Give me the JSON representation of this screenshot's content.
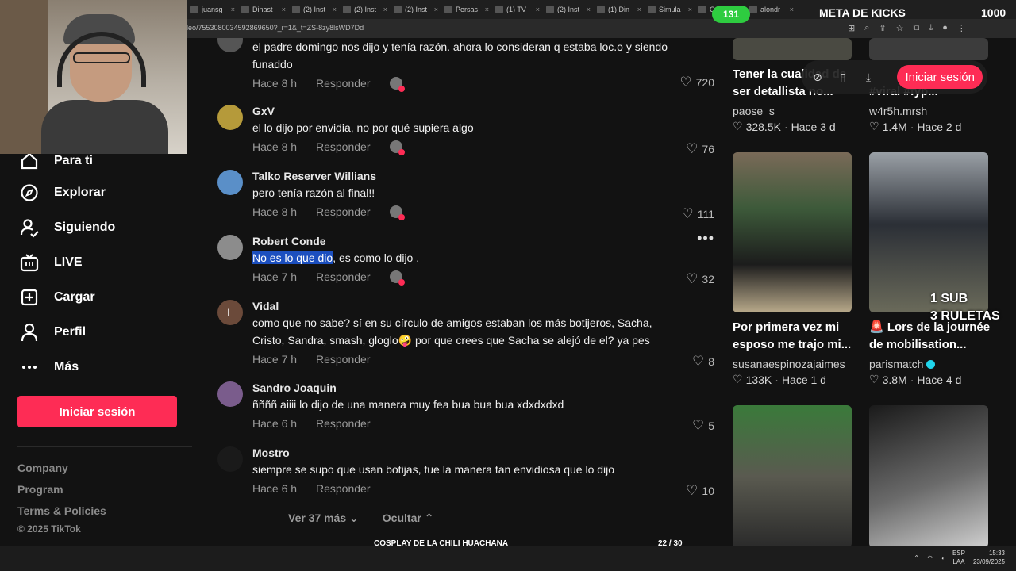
{
  "browser": {
    "tabs": [
      "juansg",
      "Dinast",
      "(2) Inst",
      "(2) Inst",
      "(2) Inst",
      "Persas",
      "(1) TV",
      "(2) Inst",
      "(1) Din",
      "Simula",
      "Quién",
      "alondr"
    ],
    "url": "deo/7553080034592869650?_r=1&_t=ZS-8zy8lsWD7Dd"
  },
  "sidebar": {
    "items": [
      {
        "label": "Para ti",
        "icon": "home-icon"
      },
      {
        "label": "Explorar",
        "icon": "compass-icon"
      },
      {
        "label": "Siguiendo",
        "icon": "following-icon"
      },
      {
        "label": "LIVE",
        "icon": "live-icon"
      },
      {
        "label": "Cargar",
        "icon": "upload-icon"
      },
      {
        "label": "Perfil",
        "icon": "profile-icon"
      },
      {
        "label": "Más",
        "icon": "more-icon"
      }
    ],
    "login_button": "Iniciar sesión",
    "footer": [
      "Company",
      "Program",
      "Terms & Policies"
    ],
    "copyright": "© 2025 TikTok"
  },
  "comments": [
    {
      "user": "",
      "text": "el padre domingo nos dijo y tenía razón. ahora lo consideran q estaba loc.o y siendo funaddo",
      "time": "Hace 8 h",
      "reply": "Responder",
      "likes": "720"
    },
    {
      "user": "GxV",
      "text": "el lo dijo por envidia, no por qué supiera algo",
      "time": "Hace 8 h",
      "reply": "Responder",
      "likes": "76"
    },
    {
      "user": "Talko Reserver Willians",
      "text": "pero tenía razón al final!!",
      "time": "Hace 8 h",
      "reply": "Responder",
      "likes": "111"
    },
    {
      "user": "Robert Conde",
      "text_selected": "No es lo que dio",
      "text_rest": ", es como lo dijo .",
      "time": "Hace 7 h",
      "reply": "Responder",
      "likes": "32"
    },
    {
      "user": "Vidal",
      "avatar_letter": "L",
      "text": "como que no sabe? sí en su círculo de amigos estaban los más botijeros, Sacha, Cristo, Sandra, smash, gloglo🤪 por que crees que Sacha se alejó de el? ya pes",
      "time": "Hace 7 h",
      "reply": "Responder",
      "likes": "8"
    },
    {
      "user": "Sandro Joaquin",
      "text": "ññññ aiiii lo dijo de una manera muy fea bua bua bua xdxdxdxd",
      "time": "Hace 6 h",
      "reply": "Responder",
      "likes": "5"
    },
    {
      "user": "Mostro",
      "text": "siempre se supo que usan botijas, fue la manera tan envidiosa que lo dijo",
      "time": "Hace 6 h",
      "reply": "Responder",
      "likes": "10"
    }
  ],
  "comment_controls": {
    "more": "Ver 37 más",
    "hide": "Ocultar"
  },
  "float_bar": {
    "login": "Iniciar sesión"
  },
  "videos": [
    {
      "title": "Tener la cualidad de ser detallista no...",
      "user": "paose_s",
      "likes": "328.5K",
      "time": "Hace 3 d",
      "verified": false
    },
    {
      "title": "#viral #fyp...",
      "user": "w4r5h.mrsh_",
      "likes": "1.4M",
      "time": "Hace 2 d",
      "verified": false
    },
    {
      "title": "Por primera vez mi esposo me trajo mi...",
      "user": "susanaespinozajaimes",
      "likes": "133K",
      "time": "Hace 1 d",
      "verified": false
    },
    {
      "title": "🚨 Lors de la journée de mobilisation...",
      "user": "parismatch",
      "likes": "3.8M",
      "time": "Hace 4 d",
      "verified": true
    }
  ],
  "stream": {
    "counter": "131",
    "goal_label": "META DE KICKS",
    "goal_value": "1000",
    "promo_line1": "1 SUB",
    "promo_line2": "3 RULETAS",
    "progress_label": "COSPLAY DE LA CHILI HUACHANA",
    "progress_count": "22 / 30",
    "progress_fraction": 0.733
  },
  "taskbar": {
    "lang1": "ESP",
    "lang2": "LAA",
    "time": "15:33",
    "date": "23/09/2025"
  },
  "colors": {
    "accent": "#fe2c55",
    "verified": "#20d5ec",
    "stream_green": "#2ecc40",
    "selection": "#1c4fbf"
  }
}
